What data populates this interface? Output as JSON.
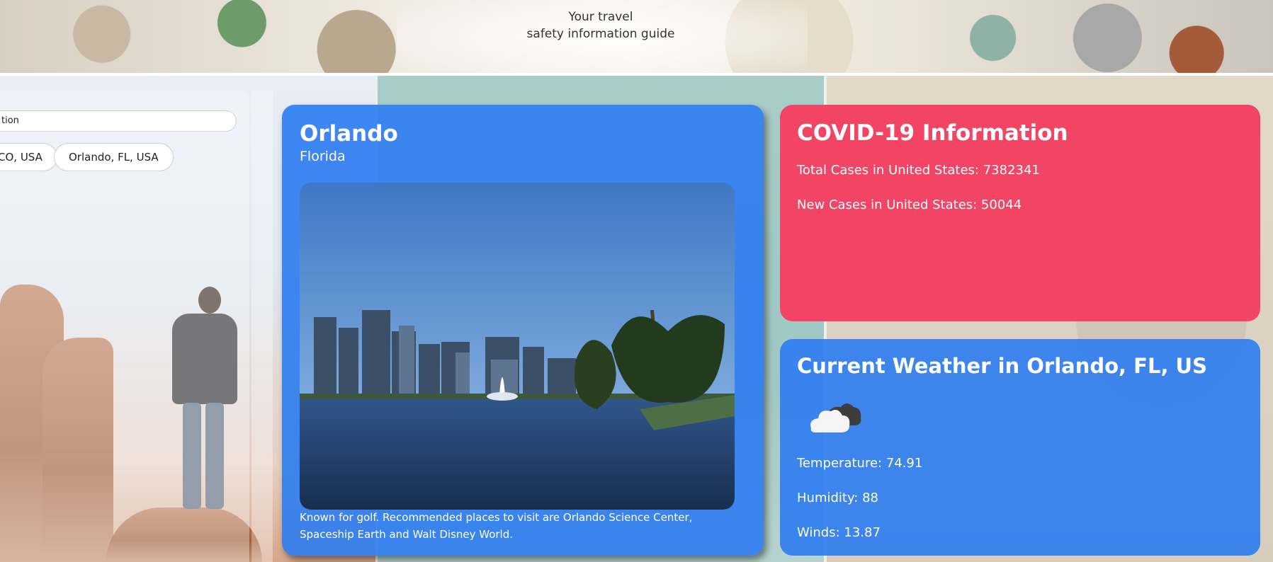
{
  "header": {
    "tagline_line1": "Your travel",
    "tagline_line2": "safety information guide"
  },
  "search": {
    "value": "tion",
    "recent_chips": [
      "CO, USA",
      "Orlando, FL, USA"
    ]
  },
  "city": {
    "name": "Orlando",
    "state": "Florida",
    "photo_icon": "city-lake-photo",
    "description": "Known for golf. Recommended places to visit are Orlando Science Center, Spaceship Earth and Walt Disney World."
  },
  "covid": {
    "title": "COVID-19 Information",
    "total_cases": "Total Cases in United States: 7382341",
    "new_cases": "New Cases in United States: 50044"
  },
  "weather": {
    "title": "Current Weather in Orlando, FL, US",
    "icon": "cloud-icon",
    "temperature": "Temperature: 74.91",
    "humidity": "Humidity: 88",
    "winds": "Winds: 13.87"
  },
  "colors": {
    "card_blue": "#307ef0",
    "covid_red": "#f24566",
    "text_white": "#ffffff"
  }
}
